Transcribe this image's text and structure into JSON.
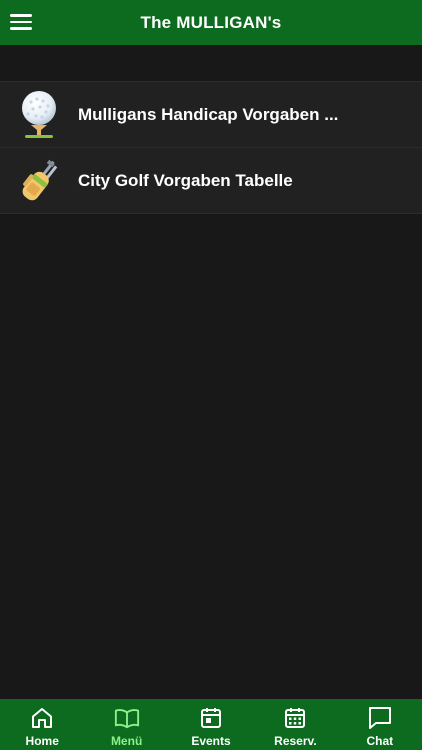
{
  "header": {
    "title": "The MULLIGAN's"
  },
  "list": {
    "items": [
      {
        "label": "Mulligans Handicap Vorgaben ...",
        "icon": "golf-ball-on-tee-icon"
      },
      {
        "label": "City Golf Vorgaben Tabelle",
        "icon": "golf-bag-icon"
      }
    ]
  },
  "tabs": [
    {
      "label": "Home",
      "icon": "home-icon"
    },
    {
      "label": "Menü",
      "icon": "book-icon",
      "active": true
    },
    {
      "label": "Events",
      "icon": "calendar-icon"
    },
    {
      "label": "Reserv.",
      "icon": "calendar-grid-icon"
    },
    {
      "label": "Chat",
      "icon": "chat-icon"
    }
  ],
  "colors": {
    "brand_green": "#0c6b1e",
    "active_tab": "#8ef08a",
    "background": "#181818"
  }
}
